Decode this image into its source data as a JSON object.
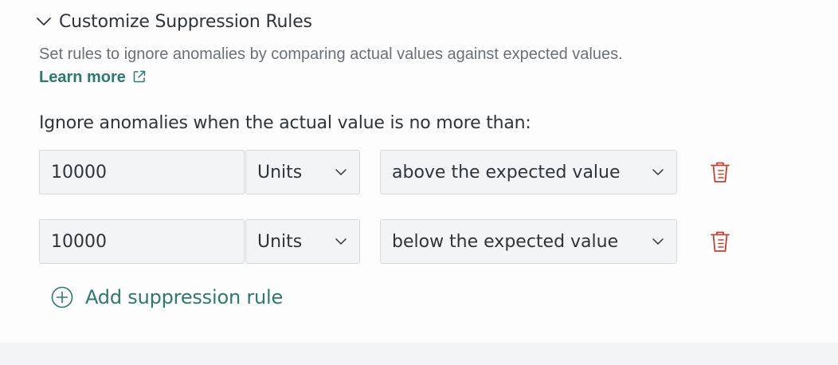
{
  "section": {
    "title": "Customize Suppression Rules",
    "chevron_icon": "chevron-down-icon"
  },
  "description": {
    "text": "Set rules to ignore anomalies by comparing actual values against expected values.",
    "learn_more": "Learn more",
    "external_icon": "external-link-icon"
  },
  "rules_label": "Ignore anomalies when the actual value is no more than:",
  "rules": [
    {
      "value": "10000",
      "unit": "Units",
      "direction": "above the expected value",
      "delete_icon": "trash-icon"
    },
    {
      "value": "10000",
      "unit": "Units",
      "direction": "below the expected value",
      "delete_icon": "trash-icon"
    }
  ],
  "add_rule": {
    "label": "Add suppression rule",
    "icon": "plus-circle-icon"
  },
  "colors": {
    "accent": "#2c7a6e",
    "delete": "#c8402f",
    "text": "#2f3439",
    "muted_text": "#6b7077",
    "field_bg": "#f3f4f5",
    "field_border": "#d6d9dd"
  }
}
